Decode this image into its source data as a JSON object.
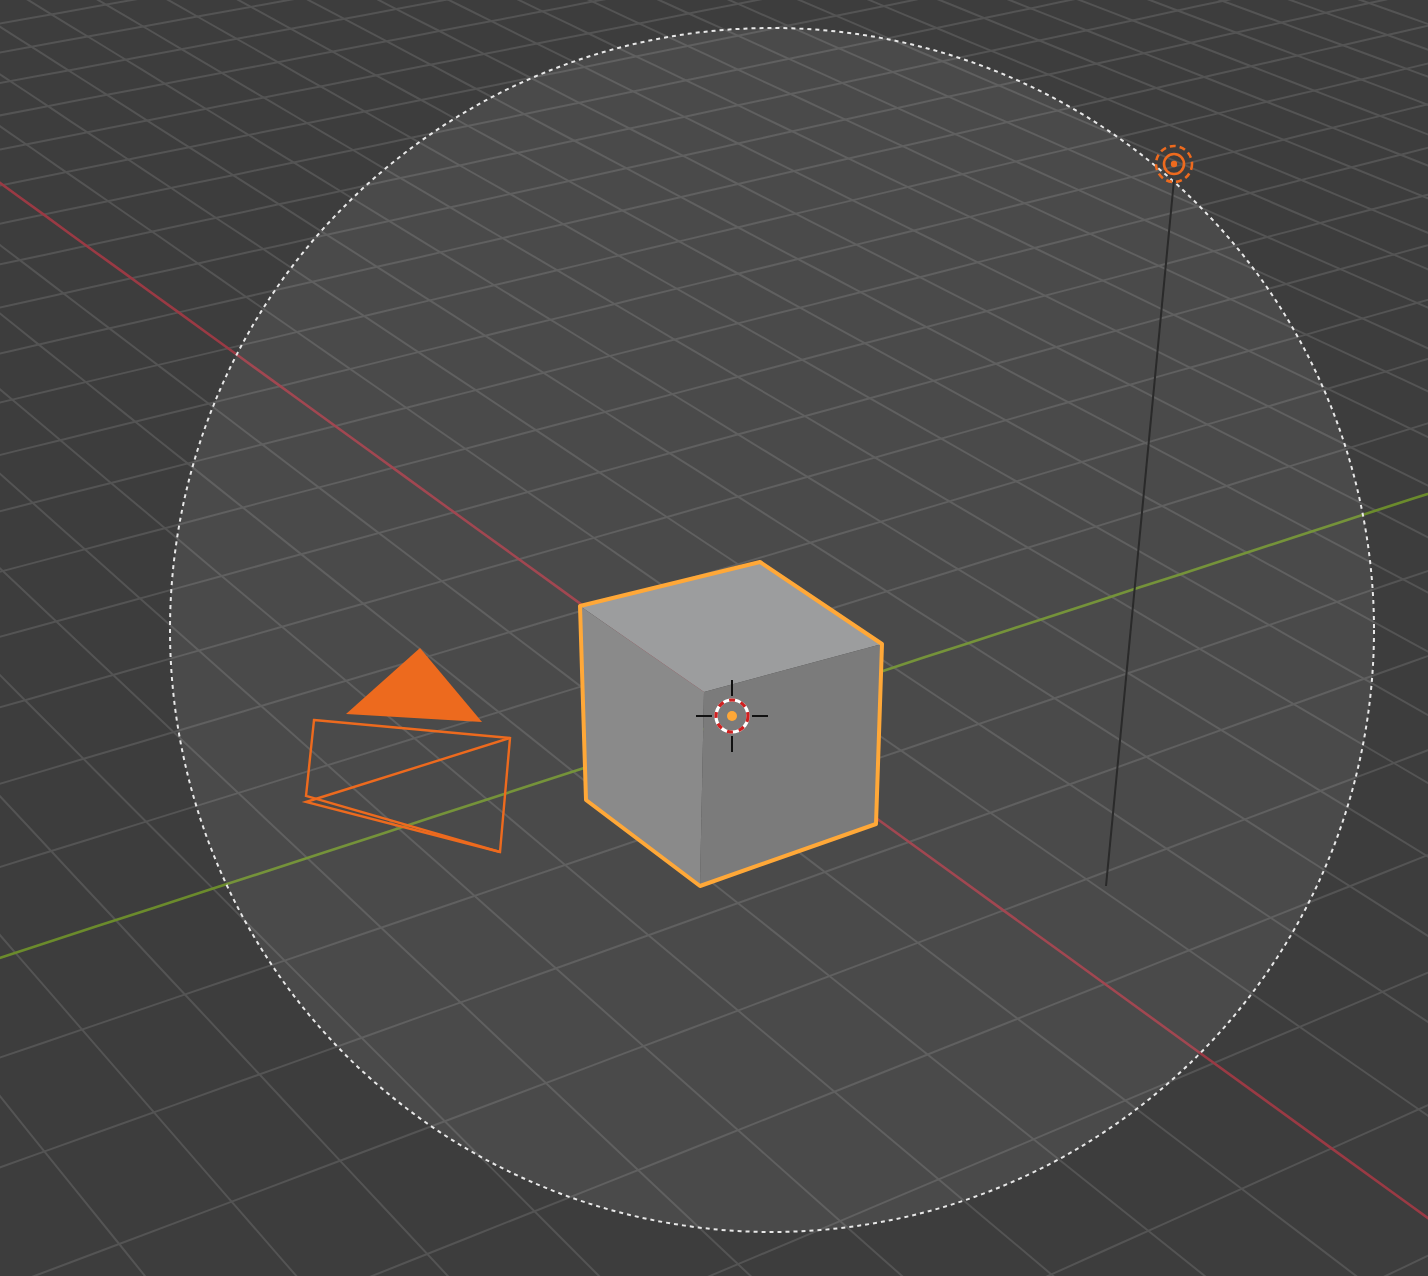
{
  "viewport": {
    "objects": [
      {
        "kind": "sphere"
      },
      {
        "kind": "camera",
        "selected": true,
        "active": false
      },
      {
        "kind": "cube",
        "selected": true,
        "active": true
      },
      {
        "kind": "light",
        "selected": true,
        "active": false
      },
      {
        "kind": "cursor"
      }
    ]
  }
}
